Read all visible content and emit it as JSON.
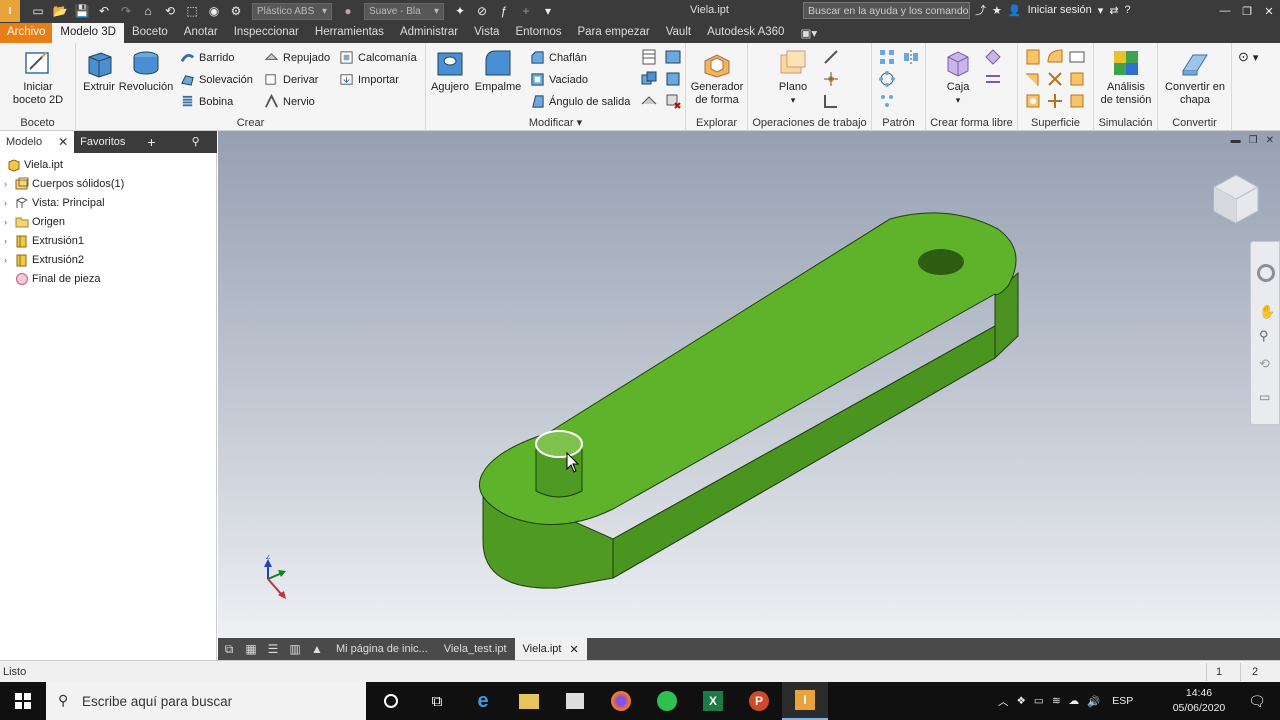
{
  "app": {
    "logo_text": "I",
    "title": "Viela.ipt",
    "search_placeholder": "Buscar en la ayuda y los comandos",
    "signin": "Iniciar sesión",
    "material": "Plástico ABS",
    "appearance": "Suave - Bla"
  },
  "tabs": [
    "Archivo",
    "Modelo 3D",
    "Boceto",
    "Anotar",
    "Inspeccionar",
    "Herramientas",
    "Administrar",
    "Vista",
    "Entornos",
    "Para empezar",
    "Vault",
    "Autodesk A360"
  ],
  "ribbon": {
    "boceto": {
      "label": "Boceto",
      "start": "Iniciar\nboceto 2D"
    },
    "crear": {
      "label": "Crear",
      "extruir": "Extruir",
      "revolucion": "Revolución",
      "barrido": "Barrido",
      "solevacion": "Solevación",
      "bobina": "Bobina",
      "repujado": "Repujado",
      "derivar": "Derivar",
      "nervio": "Nervio",
      "calcomania": "Calcomanía",
      "importar": "Importar"
    },
    "modificar": {
      "label": "Modificar ▾",
      "agujero": "Agujero",
      "empalme": "Empalme",
      "chaflan": "Chaflán",
      "vaciado": "Vaciado",
      "angulo": "Ángulo de salida"
    },
    "explorar": {
      "label": "Explorar",
      "generador": "Generador\nde forma"
    },
    "operaciones": {
      "label": "Operaciones de trabajo",
      "plano": "Plano"
    },
    "patron": {
      "label": "Patrón"
    },
    "forma_libre": {
      "label": "Crear forma libre",
      "caja": "Caja"
    },
    "superficie": {
      "label": "Superficie"
    },
    "simulacion": {
      "label": "Simulación",
      "analisis": "Análisis\nde tensión"
    },
    "convertir": {
      "label": "Convertir",
      "chapa": "Convertir en\nchapa"
    }
  },
  "browser": {
    "tab_model": "Modelo",
    "tab_fav": "Favoritos",
    "tree": [
      {
        "label": "Viela.ipt",
        "icon": "part-icon",
        "indent": 0,
        "arrow": false
      },
      {
        "label": "Cuerpos sólidos(1)",
        "icon": "solid-bodies-icon",
        "indent": 1,
        "arrow": true
      },
      {
        "label": "Vista: Principal",
        "icon": "view-icon",
        "indent": 1,
        "arrow": true
      },
      {
        "label": "Origen",
        "icon": "folder-icon",
        "indent": 1,
        "arrow": true
      },
      {
        "label": "Extrusión1",
        "icon": "extrusion-icon",
        "indent": 1,
        "arrow": true
      },
      {
        "label": "Extrusión2",
        "icon": "extrusion-icon",
        "indent": 1,
        "arrow": true
      },
      {
        "label": "Final de pieza",
        "icon": "end-of-part-icon",
        "indent": 1,
        "arrow": false
      }
    ]
  },
  "doctabs": [
    "Mi página de inic...",
    "Viela_test.ipt",
    "Viela.ipt"
  ],
  "status": {
    "text": "Listo",
    "n1": "1",
    "n2": "2"
  },
  "taskbar": {
    "search": "Escribe aquí para buscar",
    "lang": "ESP",
    "time": "14:46",
    "date": "05/06/2020"
  },
  "colors": {
    "part_green": "#5fb32a",
    "file_tab": "#e87e17",
    "titlebar": "#3b3b3b"
  }
}
